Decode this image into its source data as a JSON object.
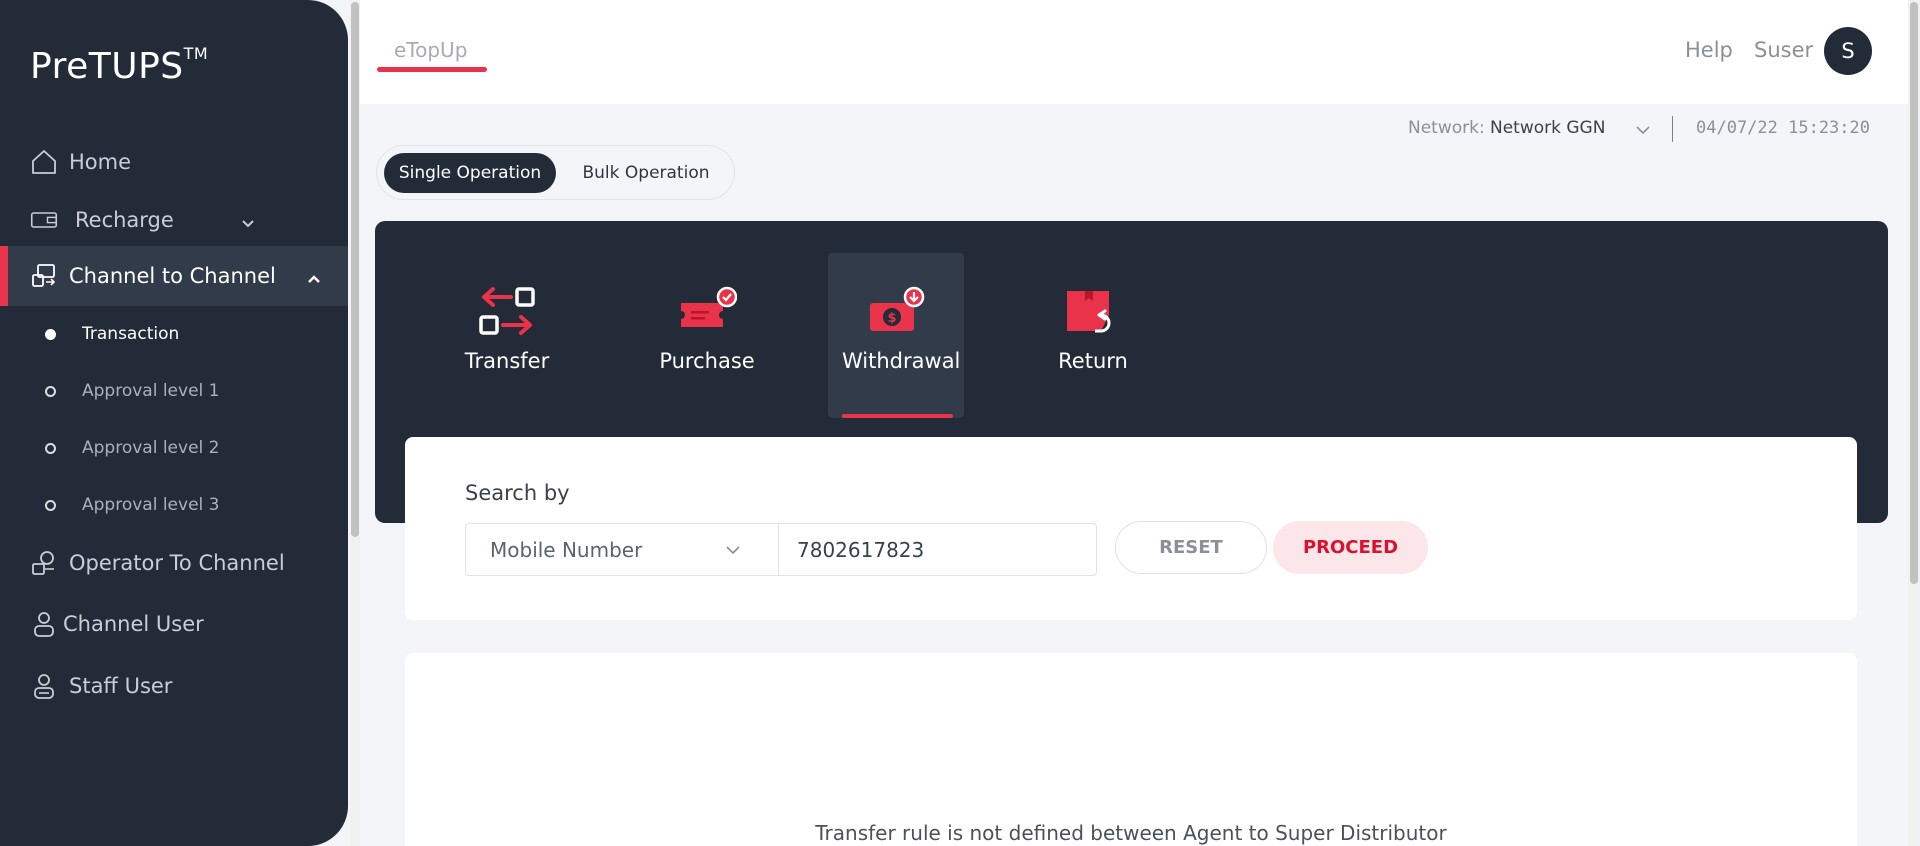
{
  "sidebar": {
    "logo": "PreTUPS",
    "logo_tm": "TM",
    "items": [
      {
        "label": "Home",
        "icon": "home-icon"
      },
      {
        "label": "Recharge",
        "icon": "recharge-icon"
      },
      {
        "label": "Channel to Channel",
        "icon": "channel-icon"
      },
      {
        "label": "Operator To Channel",
        "icon": "operator-icon"
      },
      {
        "label": "Channel User",
        "icon": "user-icon"
      },
      {
        "label": "Staff User",
        "icon": "staff-icon"
      }
    ],
    "sub_items": [
      {
        "label": "Transaction"
      },
      {
        "label": "Approval level 1"
      },
      {
        "label": "Approval level 2"
      },
      {
        "label": "Approval level 3"
      }
    ]
  },
  "header": {
    "app_tab": "eTopUp",
    "help": "Help",
    "user": "Suser",
    "avatar_initial": "S"
  },
  "network": {
    "label": "Network:",
    "value": "Network GGN",
    "datetime": "04/07/22 15:23:20"
  },
  "operation_toggle": {
    "single": "Single Operation",
    "bulk": "Bulk Operation"
  },
  "transaction_types": [
    {
      "label": "Transfer",
      "icon": "transfer-icon"
    },
    {
      "label": "Purchase",
      "icon": "purchase-icon"
    },
    {
      "label": "Withdrawal",
      "icon": "withdrawal-icon"
    },
    {
      "label": "Return",
      "icon": "return-icon"
    }
  ],
  "search": {
    "label": "Search by",
    "select_value": "Mobile Number",
    "input_value": "7802617823",
    "reset": "RESET",
    "proceed": "PROCEED"
  },
  "result": {
    "message": "Transfer rule is not defined between Agent to Super Distributor"
  },
  "colors": {
    "accent": "#e8334a",
    "sidebar_bg": "#232b38",
    "active_tile_bg": "#323b49"
  }
}
